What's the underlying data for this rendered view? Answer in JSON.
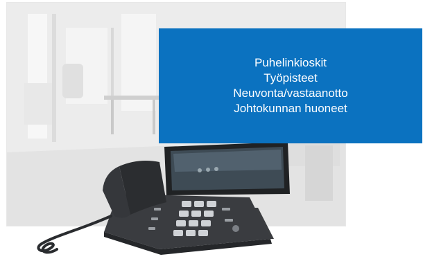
{
  "panel": {
    "lines": [
      "Puhelinkioskit",
      "Työpisteet",
      "Neuvonta/vastaanotto",
      "Johtokunnan huoneet"
    ],
    "background": "#0b72c0",
    "text_color": "#ffffff"
  },
  "photo": {
    "icon": "desk-phone-icon",
    "scene": "office-interior"
  }
}
